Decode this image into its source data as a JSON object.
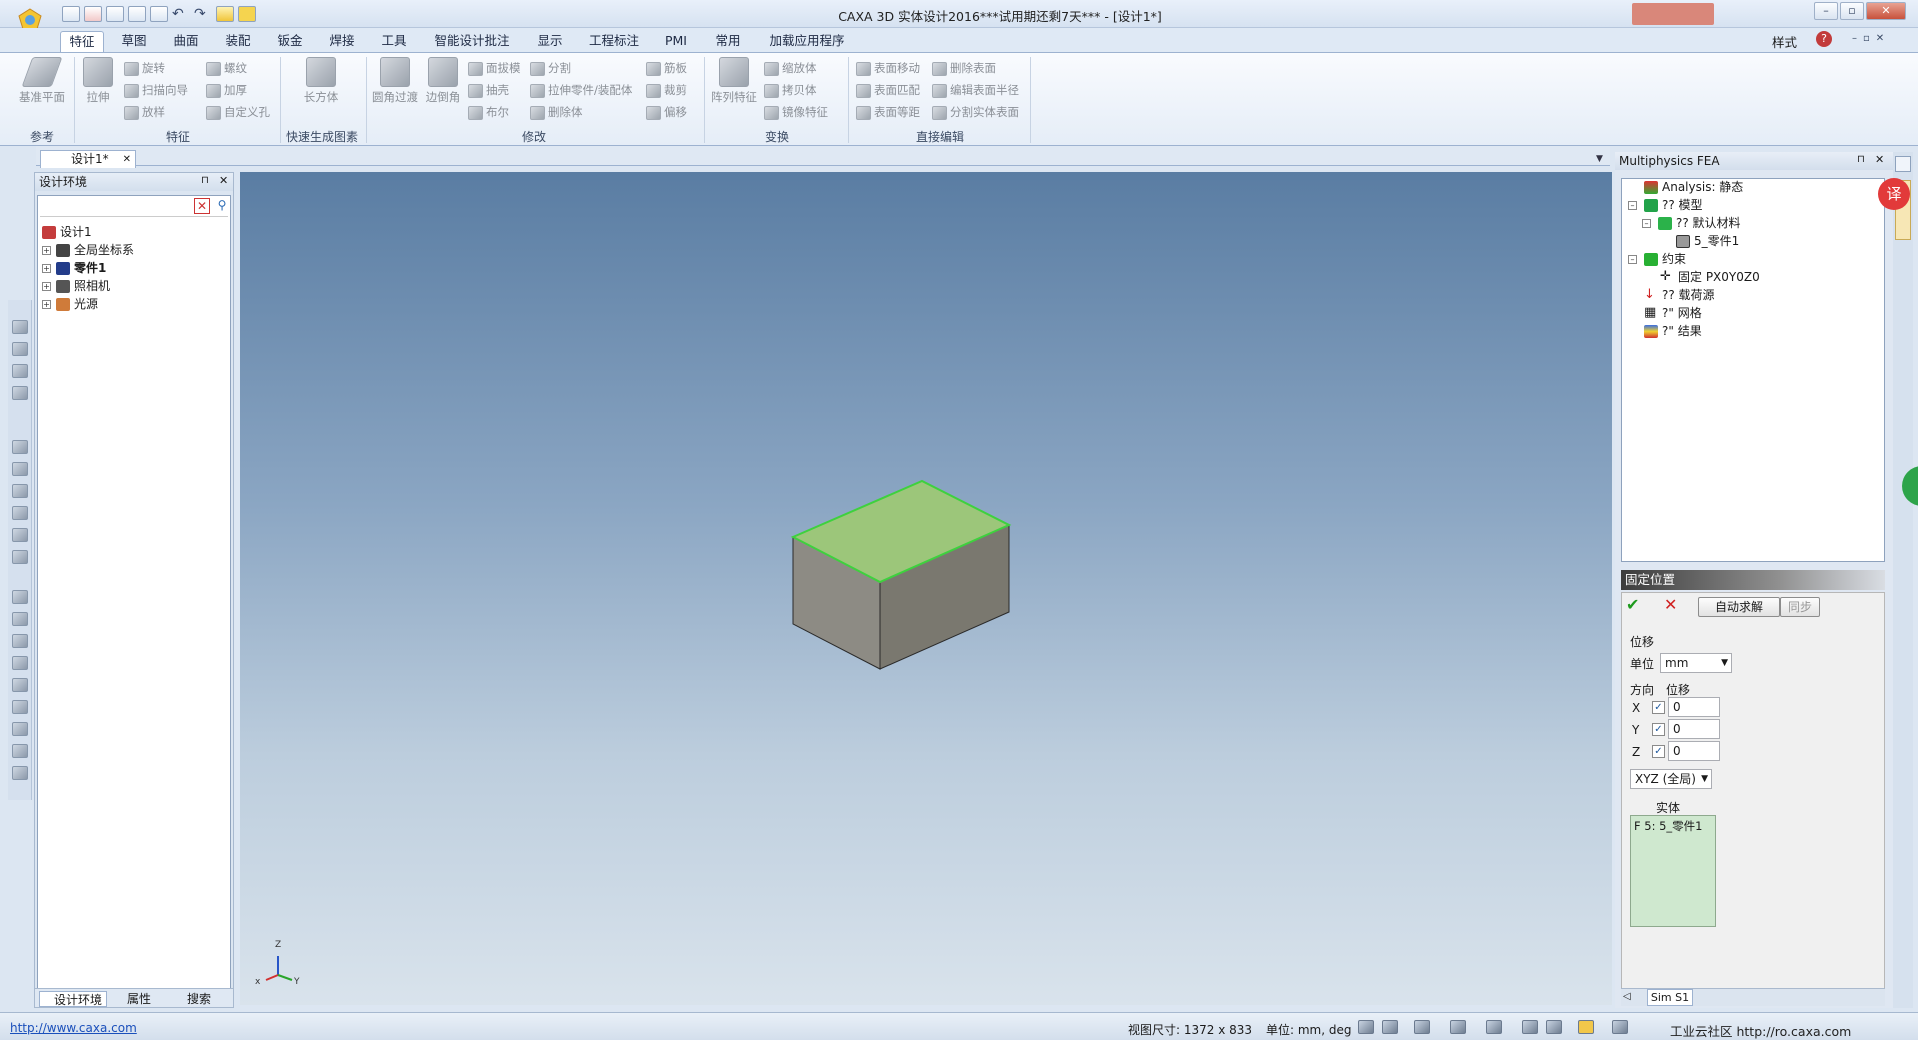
{
  "window": {
    "title": "CAXA 3D 实体设计2016***试用期还剩7天*** - [设计1*]",
    "style_label": "样式"
  },
  "ribbon": {
    "tabs": [
      "特征",
      "草图",
      "曲面",
      "装配",
      "钣金",
      "焊接",
      "工具",
      "智能设计批注",
      "显示",
      "工程标注",
      "PMI",
      "常用",
      "加载应用程序"
    ],
    "active_tab": "特征",
    "groups": {
      "ref": {
        "label": "参考",
        "datum_plane": "基准平面"
      },
      "feature": {
        "label": "特征",
        "extrude": "拉伸",
        "revolve": "旋转",
        "sweep_guide": "扫描向导",
        "loft": "放样",
        "thread": "螺纹",
        "thicken": "加厚",
        "custom_hole": "自定义孔"
      },
      "quick": {
        "label": "快速生成图素",
        "box": "长方体"
      },
      "modify": {
        "label": "修改",
        "fillet": "圆角过渡",
        "chamfer": "边倒角",
        "draft": "面拔模",
        "shell": "抽壳",
        "boolean": "布尔",
        "split": "分割",
        "extrude_part": "拉伸零件/装配体",
        "delete_body": "删除体",
        "rib": "筋板",
        "trim": "裁剪",
        "offset": "偏移"
      },
      "transform": {
        "label": "变换",
        "pattern": "阵列特征",
        "scale": "缩放体",
        "copy": "拷贝体",
        "mirror": "镜像特征"
      },
      "direct": {
        "label": "直接编辑",
        "face_move": "表面移动",
        "face_match": "表面匹配",
        "face_equidistant": "表面等距",
        "delete_face": "删除表面",
        "edit_radius": "编辑表面半径",
        "split_solid_face": "分割实体表面"
      }
    }
  },
  "document": {
    "tab": "设计1*"
  },
  "left_panel": {
    "title": "设计环境",
    "tree": [
      {
        "label": "设计1",
        "bold": false
      },
      {
        "label": "全局坐标系",
        "bold": false
      },
      {
        "label": "零件1",
        "bold": true
      },
      {
        "label": "照相机",
        "bold": false
      },
      {
        "label": "光源",
        "bold": false
      }
    ],
    "bottom_tabs": [
      "设计环境",
      "属性",
      "搜索"
    ]
  },
  "right_panel": {
    "title": "Multiphysics FEA",
    "tree": [
      {
        "label": "Analysis: 静态"
      },
      {
        "label": "?? 模型"
      },
      {
        "label": "?? 默认材料"
      },
      {
        "label": "5_零件1"
      },
      {
        "label": "约束"
      },
      {
        "label": "固定 PX0Y0Z0"
      },
      {
        "label": "?? 载荷源"
      },
      {
        "label": "?\" 网格"
      },
      {
        "label": "?\" 结果"
      }
    ],
    "fix": {
      "title": "固定位置",
      "auto_solve": "自动求解",
      "sync": "同步",
      "displacement_label": "位移",
      "unit_label": "单位",
      "unit_value": "mm",
      "direction_label": "方向",
      "disp_col_label": "位移",
      "axes": [
        {
          "axis": "X",
          "checked": true,
          "value": "0"
        },
        {
          "axis": "Y",
          "checked": true,
          "value": "0"
        },
        {
          "axis": "Z",
          "checked": true,
          "value": "0"
        }
      ],
      "coord_system": "XYZ (全局)",
      "entity_label": "实体",
      "entity_value": "F 5: 5_零件1"
    },
    "sim_tab": "Sim S1"
  },
  "axis_labels": {
    "x": "x",
    "y": "Y",
    "z": "Z"
  },
  "status": {
    "url": "http://www.caxa.com",
    "view_size": "视图尺寸: 1372 x 833",
    "units": "单位: mm, deg",
    "watermark": "工业云社区 http://ro.caxa.com"
  },
  "colors": {
    "top_face": "#9cc67a",
    "edge_highlight": "#3ed13e",
    "side_left": "#8d8b84",
    "side_right": "#7a786f"
  }
}
